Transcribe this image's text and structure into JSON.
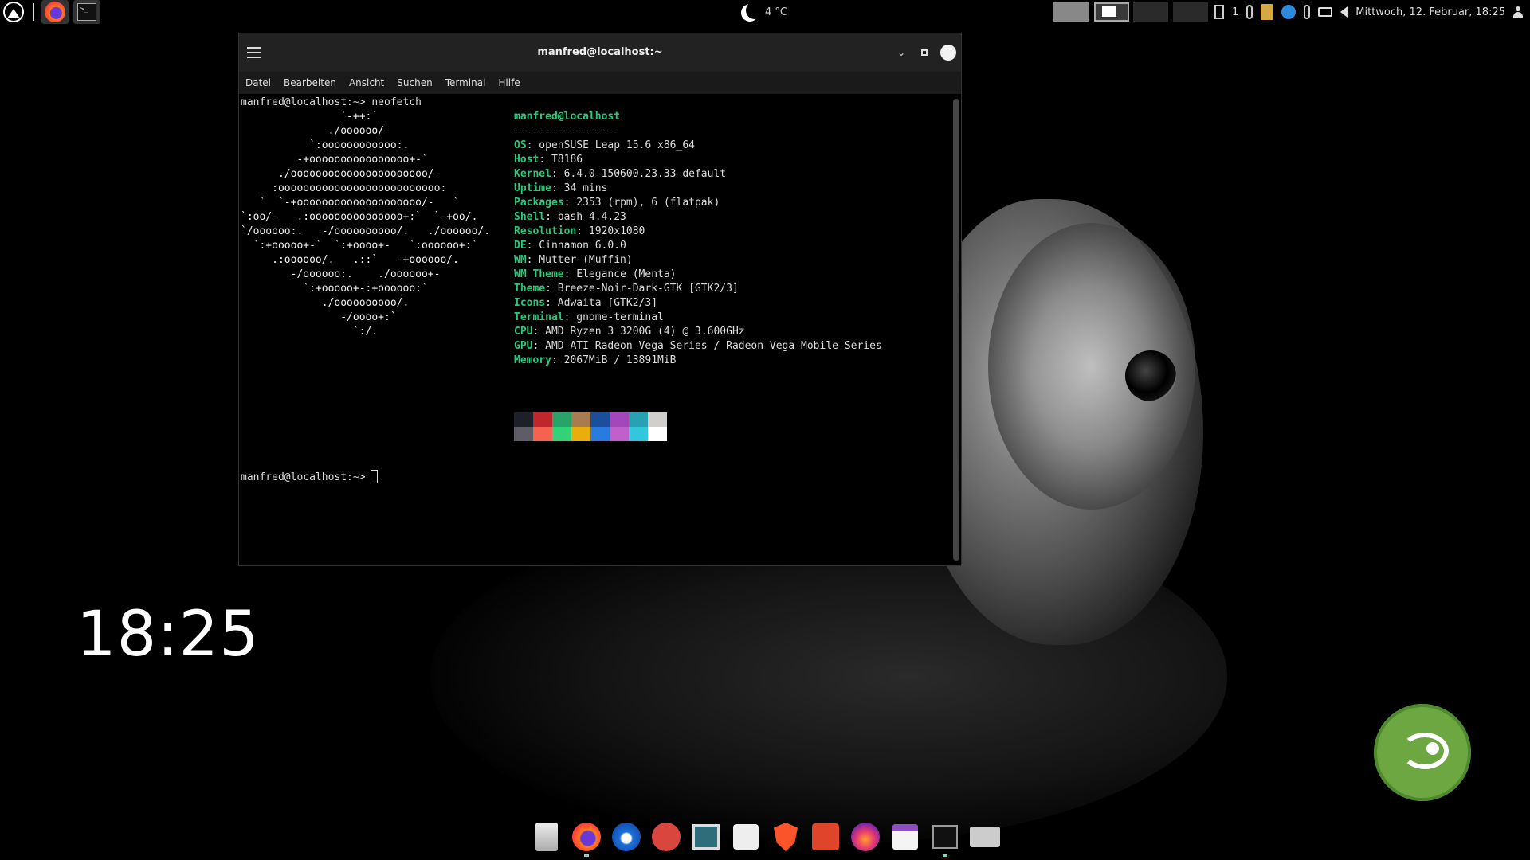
{
  "top_panel": {
    "weather": {
      "icon": "moon-icon",
      "temperature": "4 °C"
    },
    "workspaces": [
      "1",
      "2",
      "3",
      "4"
    ],
    "tray": {
      "keyboard_indicator": "1"
    },
    "clock": "Mittwoch, 12. Februar, 18:25"
  },
  "terminal": {
    "title": "manfred@localhost:~",
    "menu": [
      "Datei",
      "Bearbeiten",
      "Ansicht",
      "Suchen",
      "Terminal",
      "Hilfe"
    ],
    "prompt_cmd": "manfred@localhost:~> neofetch",
    "ascii_art": "                `-++:`\n              ./oooooo/-\n           `:oooooooooooo:.\n         -+oooooooooooooooo+-`\n      ./oooooooooooooooooooooo/-\n     :oooooooooooooooooooooooooo:\n   `  `-+oooooooooooooooooooo/-   `\n`:oo/-   .:ooooooooooooooo+:`  `-+oo/.\n`/oooooo:.   -/oooooooooo/.   ./oooooo/.\n  `:+ooooo+-`  `:+oooo+-   `:oooooo+:`\n     .:oooooo/.   .::`   -+oooooo/.\n        -/oooooo:.    ./oooooo+-\n          `:+ooooo+-:+oooooo:`\n             ./oooooooooo/.\n                -/oooo+:`\n                  `:/.",
    "user_host": "manfred@localhost",
    "separator": "-----------------",
    "info": [
      {
        "key": "OS",
        "value": ": openSUSE Leap 15.6 x86_64"
      },
      {
        "key": "Host",
        "value": ": T8186"
      },
      {
        "key": "Kernel",
        "value": ": 6.4.0-150600.23.33-default"
      },
      {
        "key": "Uptime",
        "value": ": 34 mins"
      },
      {
        "key": "Packages",
        "value": ": 2353 (rpm), 6 (flatpak)"
      },
      {
        "key": "Shell",
        "value": ": bash 4.4.23"
      },
      {
        "key": "Resolution",
        "value": ": 1920x1080"
      },
      {
        "key": "DE",
        "value": ": Cinnamon 6.0.0"
      },
      {
        "key": "WM",
        "value": ": Mutter (Muffin)"
      },
      {
        "key": "WM Theme",
        "value": ": Elegance (Menta)"
      },
      {
        "key": "Theme",
        "value": ": Breeze-Noir-Dark-GTK [GTK2/3]"
      },
      {
        "key": "Icons",
        "value": ": Adwaita [GTK2/3]"
      },
      {
        "key": "Terminal",
        "value": ": gnome-terminal"
      },
      {
        "key": "CPU",
        "value": ": AMD Ryzen 3 3200G (4) @ 3.600GHz"
      },
      {
        "key": "GPU",
        "value": ": AMD ATI Radeon Vega Series / Radeon Vega Mobile Series"
      },
      {
        "key": "Memory",
        "value": ": 2067MiB / 13891MiB"
      }
    ],
    "palette_top": [
      "#1d1f29",
      "#c0272d",
      "#28a36a",
      "#a97c50",
      "#1b4f9c",
      "#a347ba",
      "#2aa1b3",
      "#d0cfcc"
    ],
    "palette_bottom": [
      "#5e5c64",
      "#f66151",
      "#33d17a",
      "#e9ad0c",
      "#2a7bde",
      "#c061cb",
      "#33c7de",
      "#ffffff"
    ],
    "prompt_final": "manfred@localhost:~>"
  },
  "desklet_clock": "18:25",
  "dock": [
    "files-icon",
    "firefox-icon",
    "thunderbird-icon",
    "app-red-icon",
    "system-monitor-icon",
    "software-store-icon",
    "brave-icon",
    "downloader-icon",
    "flame-app-icon",
    "calendar-icon",
    "terminal-icon",
    "disks-icon"
  ]
}
